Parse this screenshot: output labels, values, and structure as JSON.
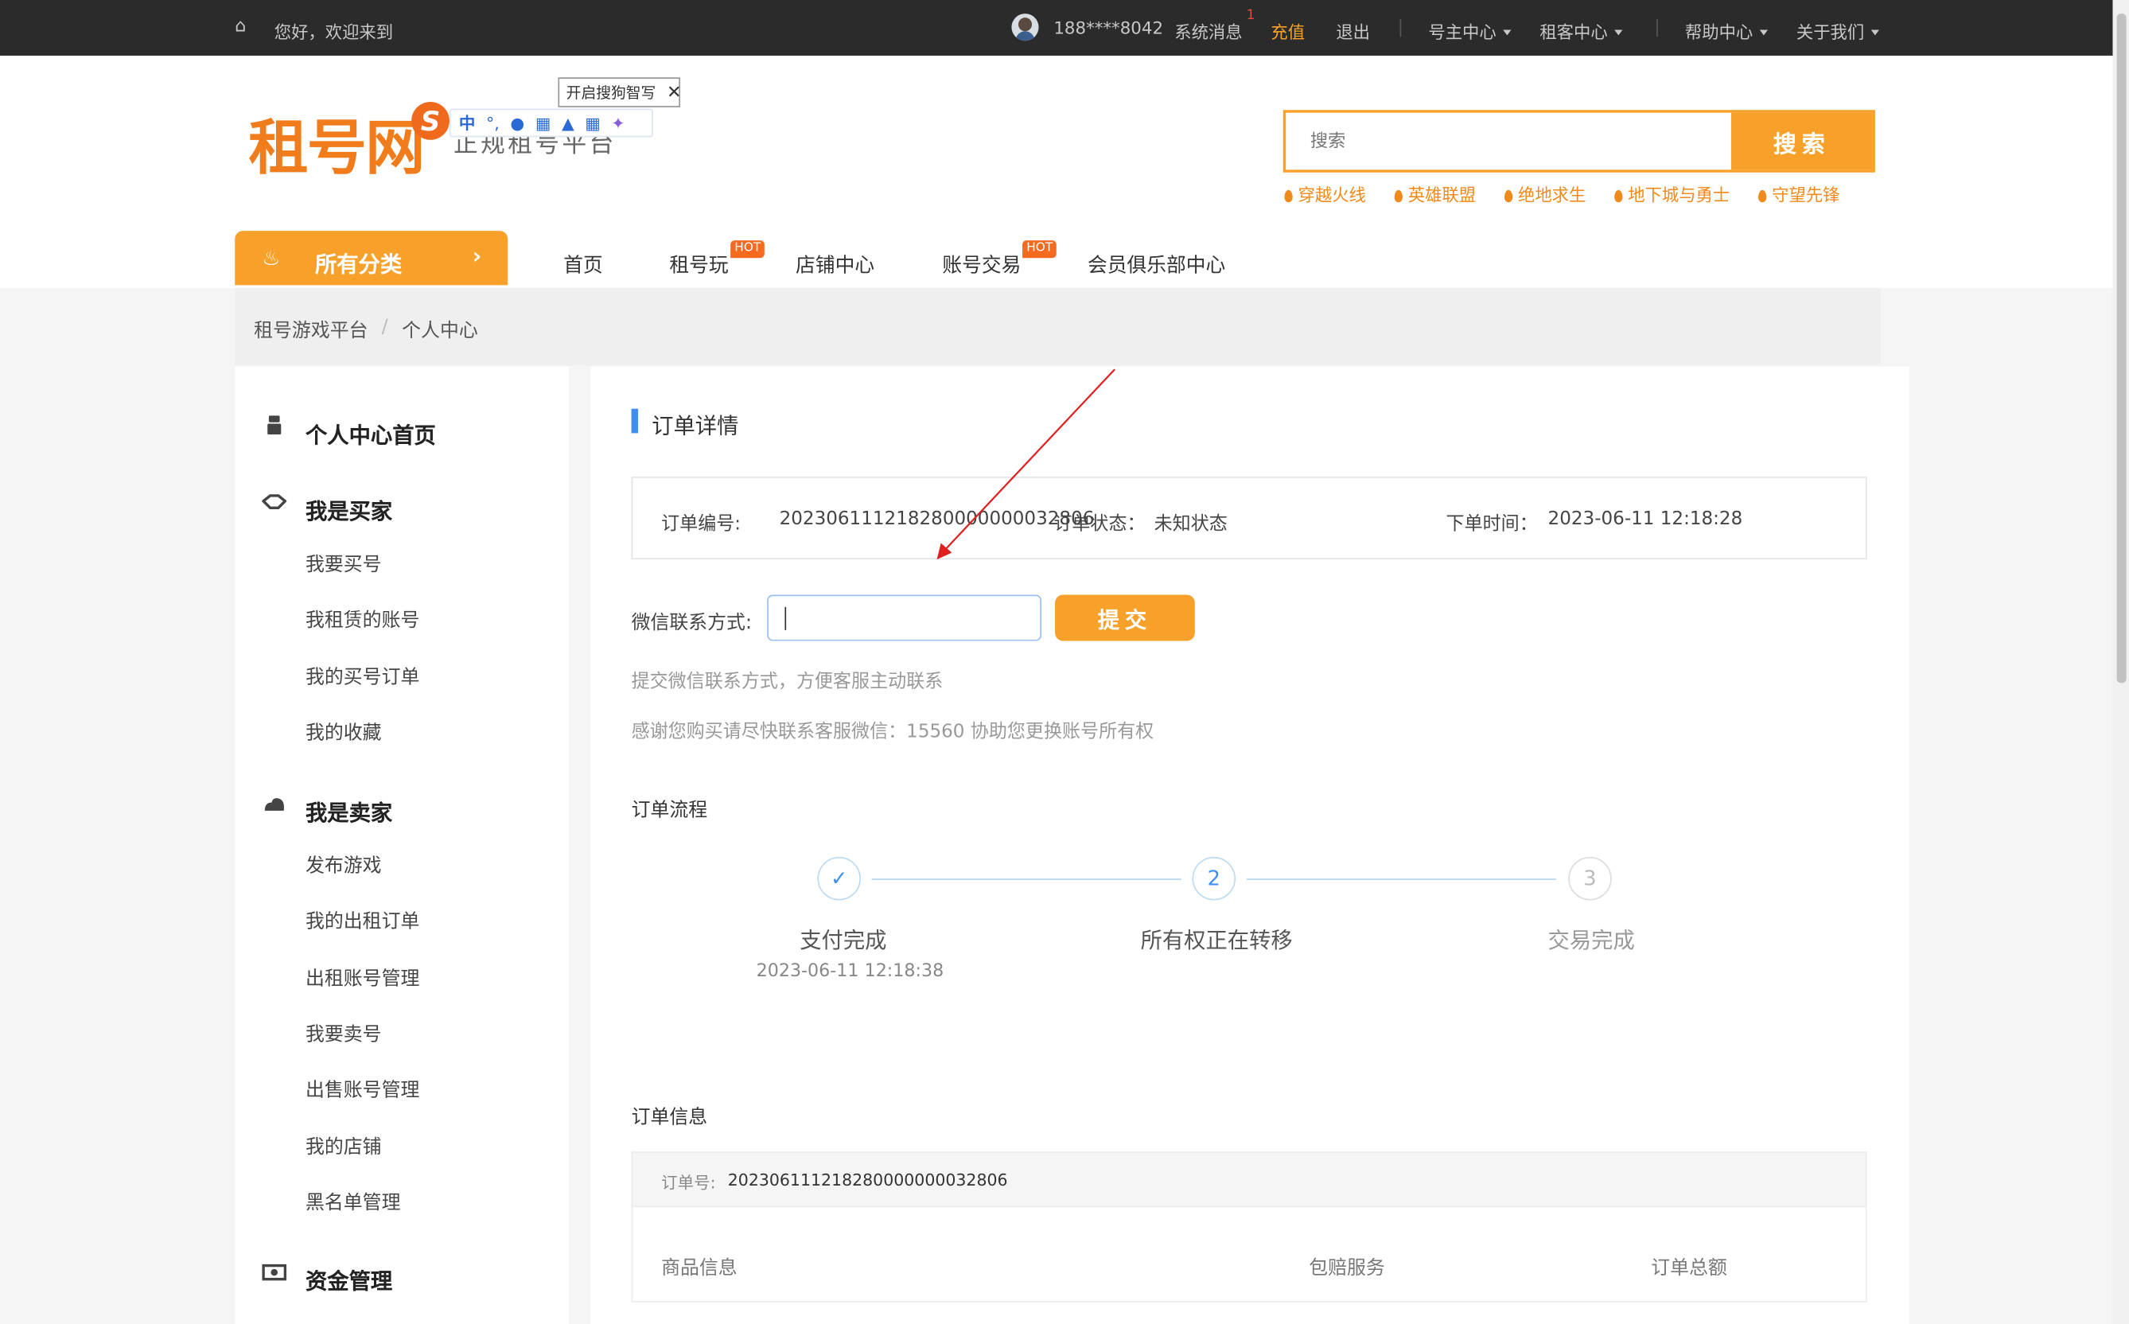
{
  "topbar": {
    "welcome": "您好，欢迎来到",
    "user_phone": "188****8042",
    "messages": "系统消息",
    "message_count": "1",
    "recharge": "充值",
    "logout": "退出",
    "owner_center": "号主中心",
    "renter_center": "租客中心",
    "help_center": "帮助中心",
    "about_us": "关于我们"
  },
  "header": {
    "logo_text": "租号网",
    "logo_sub": "正规租号平台",
    "ime_tip": "开启搜狗智写",
    "ime_mode": "中",
    "search_placeholder": "搜索",
    "search_button": "搜索",
    "hot_games": [
      "穿越火线",
      "英雄联盟",
      "绝地求生",
      "地下城与勇士",
      "守望先锋"
    ]
  },
  "nav": {
    "all_categories": "所有分类",
    "items": [
      {
        "label": "首页",
        "badge": ""
      },
      {
        "label": "租号玩",
        "badge": "HOT"
      },
      {
        "label": "店铺中心",
        "badge": ""
      },
      {
        "label": "账号交易",
        "badge": "HOT"
      },
      {
        "label": "会员俱乐部中心",
        "badge": ""
      }
    ]
  },
  "breadcrumb": {
    "root": "租号游戏平台",
    "separator": "/",
    "current": "个人中心"
  },
  "sidebar": {
    "home": "个人中心首页",
    "buyer": {
      "title": "我是买家",
      "items": [
        "我要买号",
        "我租赁的账号",
        "我的买号订单",
        "我的收藏"
      ]
    },
    "seller": {
      "title": "我是卖家",
      "items": [
        "发布游戏",
        "我的出租订单",
        "出租账号管理",
        "我要卖号",
        "出售账号管理",
        "我的店铺",
        "黑名单管理"
      ]
    },
    "funds": {
      "title": "资金管理"
    }
  },
  "order": {
    "title": "订单详情",
    "number_label": "订单编号:",
    "number": "202306111218280000000032806",
    "status_label": "订单状态：",
    "status": "未知状态",
    "time_label": "下单时间：",
    "time": "2023-06-11 12:18:28",
    "wechat_label": "微信联系方式:",
    "wechat_value": "",
    "submit": "提交",
    "hint1": "提交微信联系方式，方便客服主动联系",
    "hint2": "感谢您购买请尽快联系客服微信：15560 协助您更换账号所有权",
    "flow_title": "订单流程",
    "steps": [
      {
        "num": "✓",
        "label": "支付完成",
        "time": "2023-06-11 12:18:38",
        "state": "done"
      },
      {
        "num": "2",
        "label": "所有权正在转移",
        "time": "",
        "state": "active"
      },
      {
        "num": "3",
        "label": "交易完成",
        "time": "",
        "state": "pending"
      }
    ],
    "info_title": "订单信息",
    "info_order_label": "订单号:",
    "info_order_number": "202306111218280000000032806",
    "columns": [
      "商品信息",
      "包赔服务",
      "订单总额"
    ]
  },
  "colors": {
    "accent": "#f7a12a",
    "topbar": "#2b2b2b",
    "blue": "#3f8ff0",
    "annotation": "#e02020"
  }
}
